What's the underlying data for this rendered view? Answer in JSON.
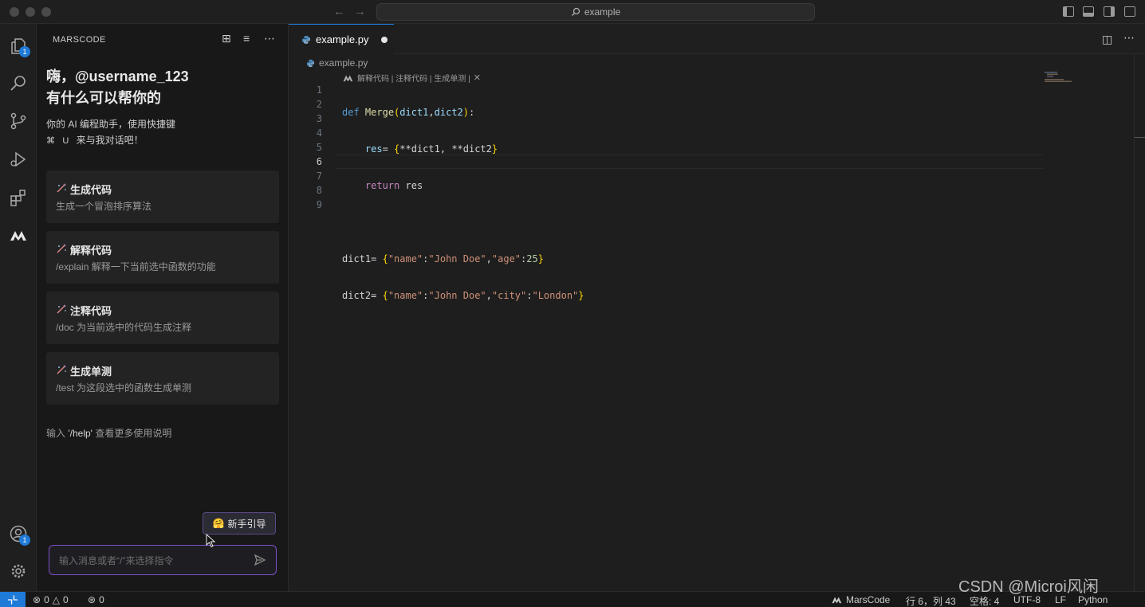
{
  "titlebar": {
    "search_text": "example"
  },
  "activity": {
    "explorer_badge": "1",
    "account_badge": "1"
  },
  "sidebar": {
    "header": "MARSCODE",
    "greeting_line1": "嗨，@username_123",
    "greeting_line2": "有什么可以帮你的",
    "intro_line1": "你的 AI 编程助手，使用快捷键",
    "intro_key_cmd": "⌘",
    "intro_key_u": "U",
    "intro_line2": "来与我对话吧！",
    "cards": [
      {
        "title": "生成代码",
        "desc": "生成一个冒泡排序算法"
      },
      {
        "title": "解释代码",
        "desc": "/explain 解释一下当前选中函数的功能"
      },
      {
        "title": "注释代码",
        "desc": "/doc 为当前选中的代码生成注释"
      },
      {
        "title": "生成单测",
        "desc": "/test 为这段选中的函数生成单测"
      }
    ],
    "help_prefix": "输入",
    "help_cmd": "'/help'",
    "help_suffix": "查看更多使用说明",
    "guide_emoji": "🤗",
    "guide_label": "新手引导",
    "chat_placeholder": "输入消息或者“/”来选择指令"
  },
  "editor": {
    "tab_label": "example.py",
    "breadcrumb": "example.py",
    "codelens": "解释代码 | 注释代码 | 生成单测 |",
    "line_numbers": [
      "1",
      "2",
      "3",
      "4",
      "5",
      "6",
      "7",
      "8",
      "9"
    ],
    "active_line": 6,
    "code": {
      "l1_def": "def",
      "l1_name": "Merge",
      "l1_p1": "dict1",
      "l1_p2": "dict2",
      "l2_var": "res",
      "l2_a": "**dict1",
      "l2_b": "**dict2",
      "l3_ret": "return",
      "l3_var": "res",
      "l5_var": "dict1",
      "l5_k1": "\"name\"",
      "l5_v1": "\"John Doe\"",
      "l5_k2": "\"age\"",
      "l5_v2": "25",
      "l6_var": "dict2",
      "l6_k1": "\"name\"",
      "l6_v1": "\"John Doe\"",
      "l6_k2": "\"city\"",
      "l6_v2": "\"London\""
    }
  },
  "statusbar": {
    "errors": "0",
    "warnings": "0",
    "ports": "0",
    "marscode": "MarsCode",
    "position": "行 6，列 43",
    "spaces": "空格: 4",
    "encoding": "UTF-8",
    "eol": "LF",
    "language": "Python"
  },
  "watermark": "CSDN @Microi风闲",
  "colors": {
    "accent": "#1f7ad8",
    "input_border": "#7b4fc9"
  }
}
